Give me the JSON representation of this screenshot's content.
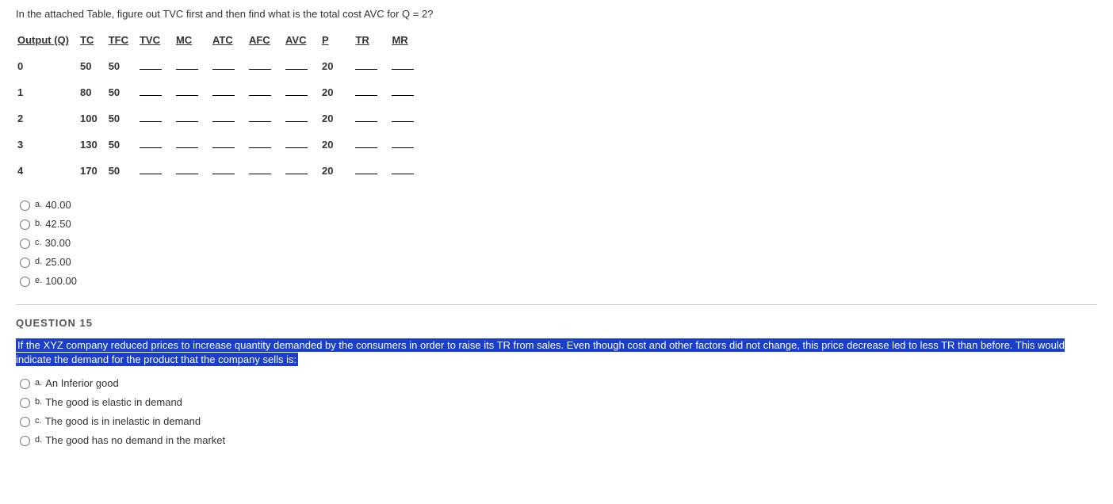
{
  "q14": {
    "intro": "In the attached Table, figure out TVC first and then find what is the total cost AVC for Q = 2?",
    "headers": [
      "Output (Q)",
      "TC",
      "TFC",
      "TVC",
      "MC",
      "ATC",
      "AFC",
      "AVC",
      "P",
      "",
      "TR",
      "MR"
    ],
    "rows": [
      {
        "q": "0",
        "tc": "50",
        "tfc": "50",
        "p": "20"
      },
      {
        "q": "1",
        "tc": "80",
        "tfc": "50",
        "p": "20"
      },
      {
        "q": "2",
        "tc": "100",
        "tfc": "50",
        "p": "20"
      },
      {
        "q": "3",
        "tc": "130",
        "tfc": "50",
        "p": "20"
      },
      {
        "q": "4",
        "tc": "170",
        "tfc": "50",
        "p": "20"
      }
    ],
    "options": [
      {
        "letter": "a.",
        "text": "40.00"
      },
      {
        "letter": "b.",
        "text": "42.50"
      },
      {
        "letter": "c.",
        "text": "30.00"
      },
      {
        "letter": "d.",
        "text": "25.00"
      },
      {
        "letter": "e.",
        "text": "100.00"
      }
    ]
  },
  "q15": {
    "header": "QUESTION 15",
    "text": "If the XYZ company reduced prices to increase quantity demanded by the consumers in order to raise its TR from sales. Even though cost and other factors did not change, this price decrease led to less TR than before. This would indicate the demand for the product that the company sells is:",
    "options": [
      {
        "letter": "a.",
        "text": "An Inferior good"
      },
      {
        "letter": "b.",
        "text": "The good is elastic in demand"
      },
      {
        "letter": "c.",
        "text": "The good is in inelastic in demand"
      },
      {
        "letter": "d.",
        "text": "The good has no demand in the market"
      }
    ]
  }
}
